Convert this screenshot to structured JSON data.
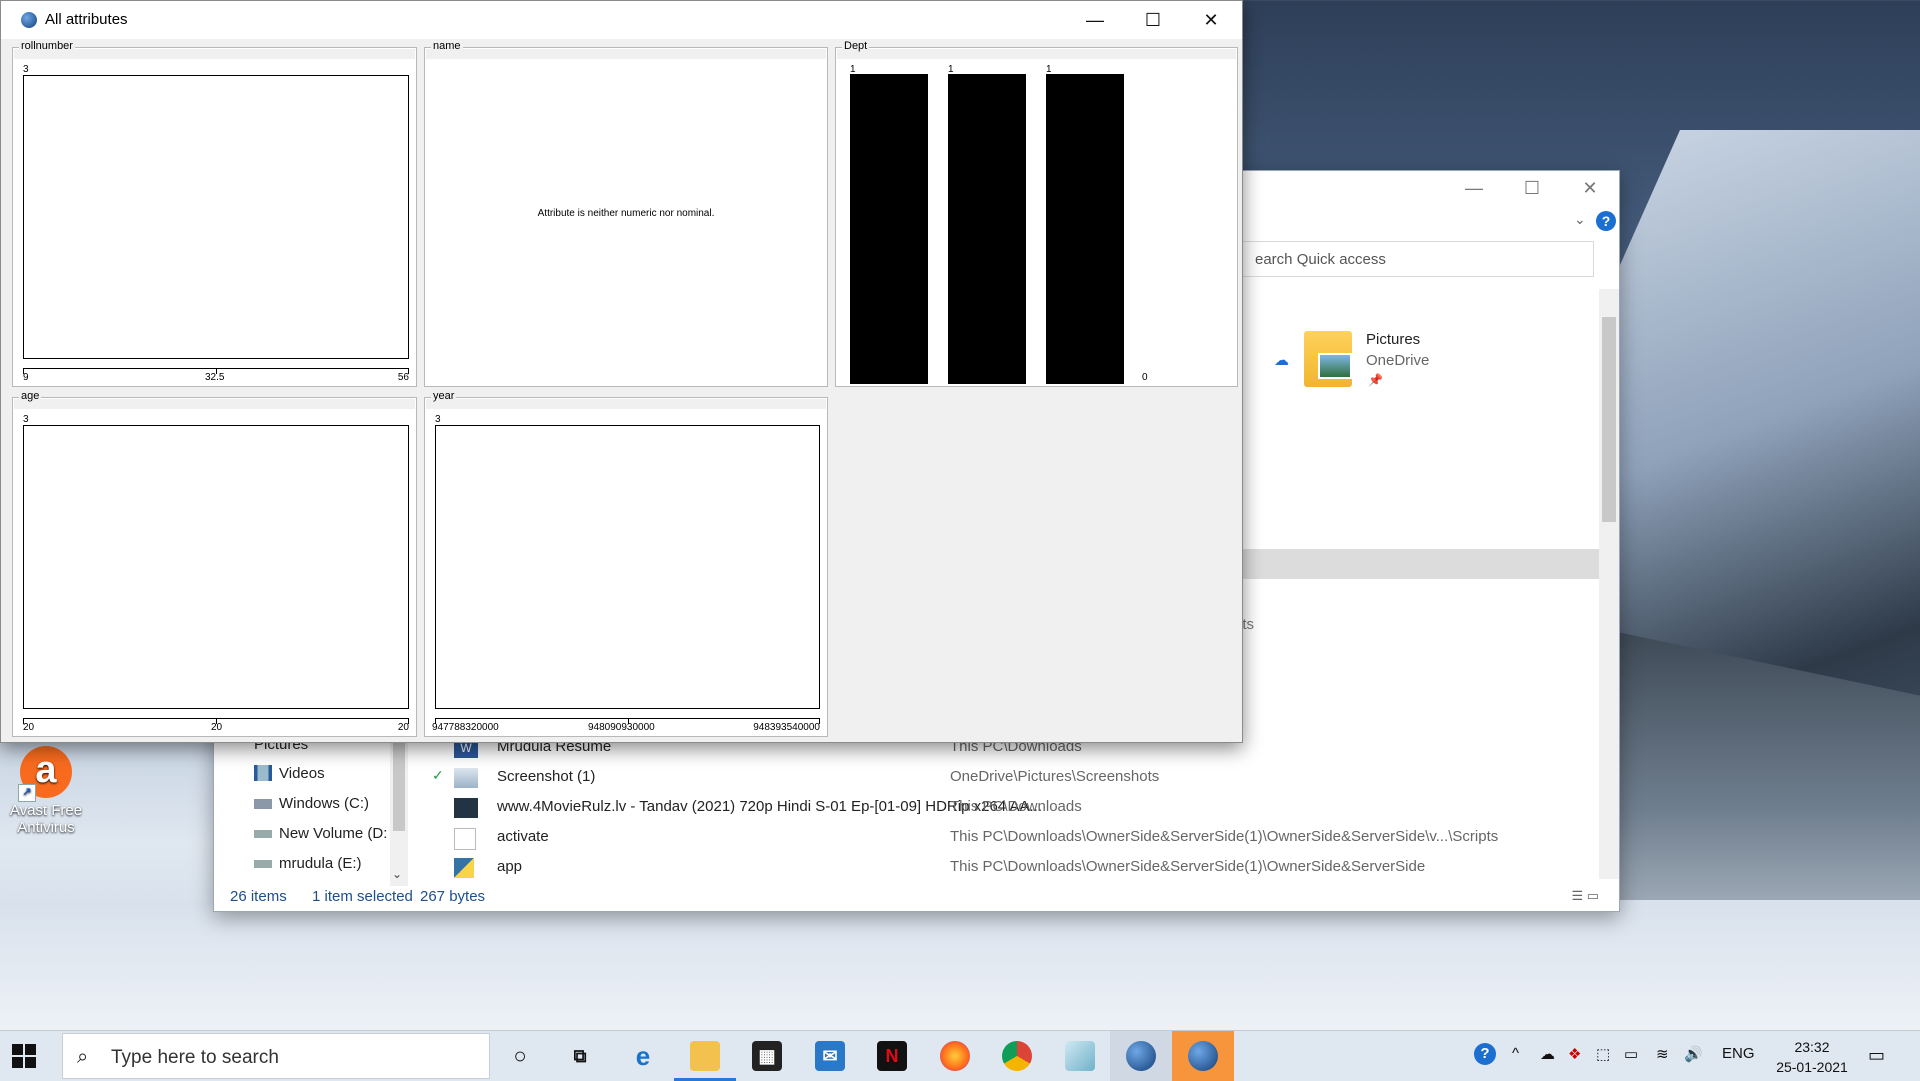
{
  "desktop": {
    "icon_label": "Avast Free Antivirus"
  },
  "explorer": {
    "search_placeholder": "Search Quick access",
    "search_visible_text": "earch Quick access",
    "quick_access": {
      "name": "Pictures",
      "location": "OneDrive"
    },
    "partial_text": "ots",
    "nav_items": [
      "Pictures",
      "Videos",
      "Windows (C:)",
      "New Volume (D:",
      "mrudula (E:)"
    ],
    "files": [
      {
        "name": "Mrudula Resume",
        "path": "This PC\\Downloads"
      },
      {
        "name": "Screenshot (1)",
        "path": "OneDrive\\Pictures\\Screenshots"
      },
      {
        "name": "www.4MovieRulz.lv - Tandav (2021) 720p Hindi S-01 Ep-[01-09] HDRip x264 AA...",
        "path": "This PC\\Downloads"
      },
      {
        "name": "activate",
        "path": "This PC\\Downloads\\OwnerSide&ServerSide(1)\\OwnerSide&ServerSide\\v...\\Scripts"
      },
      {
        "name": "app",
        "path": "This PC\\Downloads\\OwnerSide&ServerSide(1)\\OwnerSide&ServerSide"
      }
    ],
    "status": {
      "count": "26 items",
      "selected": "1 item selected",
      "size": "267 bytes"
    }
  },
  "weka": {
    "title": "All attributes",
    "panels": {
      "rollnumber": {
        "label": "rollnumber",
        "max": "3",
        "ticks": [
          "9",
          "32.5",
          "56"
        ]
      },
      "name": {
        "label": "name",
        "message": "Attribute is neither numeric nor nominal."
      },
      "dept": {
        "label": "Dept",
        "counts": [
          "1",
          "1",
          "1"
        ],
        "zero": "0"
      },
      "age": {
        "label": "age",
        "max": "3",
        "ticks": [
          "20",
          "20",
          "20"
        ]
      },
      "year": {
        "label": "year",
        "max": "3",
        "ticks": [
          "947788320000",
          "948090930000",
          "948393540000"
        ]
      }
    }
  },
  "taskbar": {
    "search_placeholder": "Type here to search",
    "language": "ENG",
    "time": "23:32",
    "date": "25-01-2021"
  },
  "chart_data": [
    {
      "type": "bar",
      "title": "rollnumber",
      "x": [
        9,
        32.5,
        56
      ],
      "values": [],
      "ylim": [
        0,
        3
      ]
    },
    {
      "type": "bar",
      "title": "Dept",
      "categories": [
        "",
        "",
        "",
        ""
      ],
      "values": [
        1,
        1,
        1,
        0
      ]
    },
    {
      "type": "bar",
      "title": "age",
      "x": [
        20,
        20,
        20
      ],
      "values": [],
      "ylim": [
        0,
        3
      ]
    },
    {
      "type": "bar",
      "title": "year",
      "x": [
        947788320000,
        948090930000,
        948393540000
      ],
      "values": [],
      "ylim": [
        0,
        3
      ]
    }
  ]
}
